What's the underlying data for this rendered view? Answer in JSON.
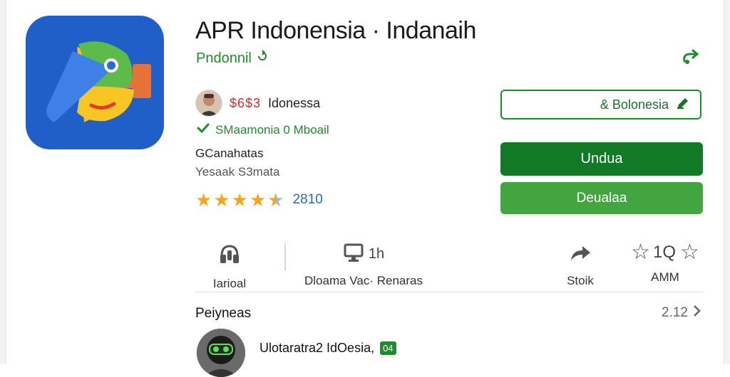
{
  "app": {
    "title": "APR Indonensia · Indanaih",
    "publisher": "Pndonnil",
    "publisher_icon": "refresh-icon"
  },
  "developer": {
    "code": "$6$3",
    "name": "Idonessa"
  },
  "verified": {
    "label": "SMaamonia 0 Mboail"
  },
  "category": "GCanahatas",
  "sub_category": "Yesaak S3mata",
  "rating": {
    "stars": 4.5,
    "count": "2810"
  },
  "buttons": {
    "outline_label": "& Bolonesia",
    "install_label": "Undua",
    "detail_label": "Deualaa"
  },
  "stats": [
    {
      "label": "Iarioal",
      "icon": "headphones-icon"
    },
    {
      "label": "Dloama Vac· Renaras",
      "value": "1h",
      "icon": "monitor-icon"
    },
    {
      "label": "Stoik",
      "icon": "share-icon"
    },
    {
      "label": "AMM",
      "value": "1Q",
      "icon": "star-outline-icon"
    }
  ],
  "reviews_section": {
    "title": "Peiyneas",
    "count": "2.12"
  },
  "review": {
    "text": "Ulotaratra2 IdOesia,",
    "badge": "04"
  },
  "colors": {
    "brand_green": "#127a26",
    "light_green": "#43a53f",
    "icon_bg": "#1f5fc7",
    "star": "#f4a521"
  }
}
